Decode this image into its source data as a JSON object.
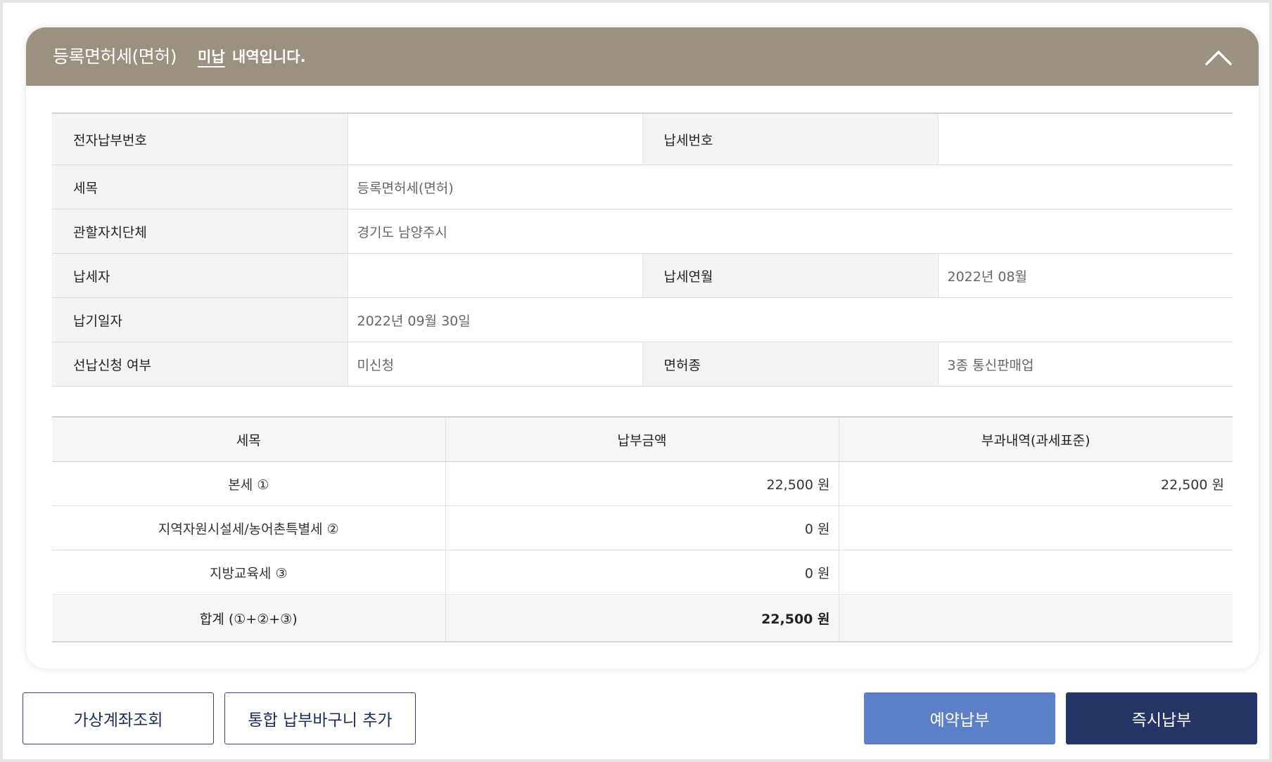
{
  "header": {
    "title": "등록면허세(면허)",
    "status": "미납",
    "suffix": "내역입니다."
  },
  "info": {
    "epay_no_label": "전자납부번호",
    "epay_no_value": "",
    "tax_no_label": "납세번호",
    "tax_no_value": "",
    "item_label": "세목",
    "item_value": "등록면허세(면허)",
    "gov_label": "관할자치단체",
    "gov_value": "경기도 남양주시",
    "payer_label": "납세자",
    "payer_value": "",
    "period_label": "납세연월",
    "period_value": "2022년 08월",
    "due_label": "납기일자",
    "due_value": "2022년 09월 30일",
    "prepay_label": "선납신청 여부",
    "prepay_value": "미신청",
    "license_label": "면허종",
    "license_value": "3종 통신판매업"
  },
  "amounts": {
    "headers": [
      "세목",
      "납부금액",
      "부과내역(과세표준)"
    ],
    "rows": [
      {
        "name": "본세 ①",
        "amount": "22,500 원",
        "basis": "22,500 원"
      },
      {
        "name": "지역자원시설세/농어촌특별세 ②",
        "amount": "0 원",
        "basis": ""
      },
      {
        "name": "지방교육세 ③",
        "amount": "0 원",
        "basis": ""
      }
    ],
    "total": {
      "name": "합계 (①+②+③)",
      "amount": "22,500 원",
      "basis": ""
    }
  },
  "buttons": {
    "virtual_account": "가상계좌조회",
    "add_basket": "통합 납부바구니 추가",
    "reserve_pay": "예약납부",
    "pay_now": "즉시납부"
  },
  "icons": {
    "collapse": "chevron-up-icon"
  },
  "colors": {
    "header_bg": "#9a9180",
    "primary_dark": "#253566",
    "primary_light": "#5b80c8"
  }
}
